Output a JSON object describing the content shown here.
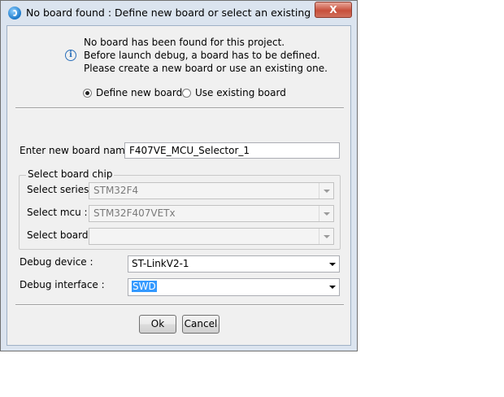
{
  "window": {
    "title": "No board found : Define new board or select an existing board",
    "close_glyph": "X"
  },
  "info": {
    "icon_glyph": "i",
    "lines": [
      "No board has been found for this project.",
      "Before launch debug, a board has to be defined.",
      "Please create a new board or use an existing one."
    ]
  },
  "mode": {
    "define_new": "Define new board",
    "use_existing": "Use existing board",
    "selected": "define_new"
  },
  "board_name": {
    "label": "Enter new board name :",
    "value": "F407VE_MCU_Selector_1"
  },
  "chip_group": {
    "title": "Select board chip",
    "series_label": "Select series :",
    "series_value": "STM32F4",
    "mcu_label": "Select mcu :",
    "mcu_value": "STM32F407VETx",
    "board_label": "Select board :",
    "board_value": ""
  },
  "debug": {
    "device_label": "Debug device :",
    "device_value": "ST-LinkV2-1",
    "interface_label": "Debug interface :",
    "interface_value": "SWD"
  },
  "buttons": {
    "ok": "Ok",
    "cancel": "Cancel"
  }
}
